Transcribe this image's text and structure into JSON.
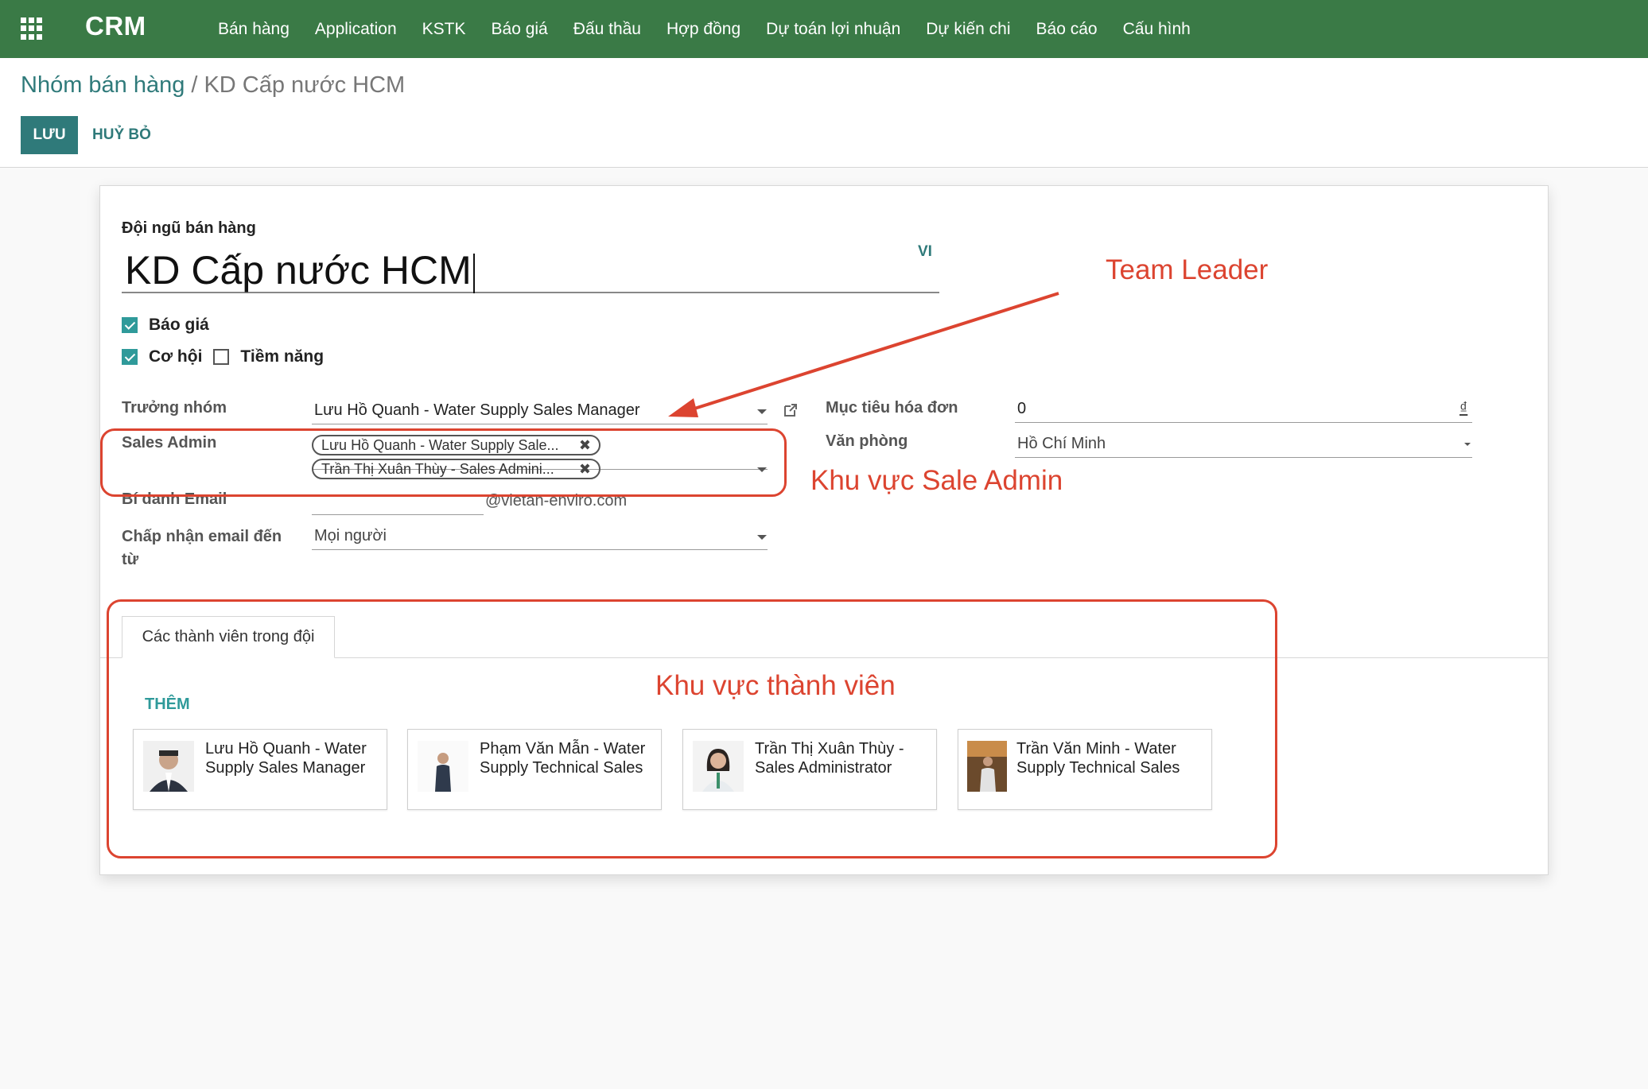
{
  "navbar": {
    "brand": "CRM",
    "menu": [
      "Bán hàng",
      "Application",
      "KSTK",
      "Báo giá",
      "Đấu thầu",
      "Hợp đồng",
      "Dự toán lợi nhuận",
      "Dự kiến chi",
      "Báo cáo",
      "Cấu hình"
    ]
  },
  "breadcrumb": {
    "parent": "Nhóm bán hàng",
    "separator": "/",
    "current": "KD Cấp nước HCM"
  },
  "actions": {
    "save": "LƯU",
    "cancel": "HUỶ BỎ"
  },
  "form": {
    "title_label": "Đội ngũ bán hàng",
    "title_value": "KD Cấp nước HCM",
    "lang": "VI",
    "checkboxes": [
      {
        "label": "Báo giá",
        "checked": true
      },
      {
        "label": "Cơ hội",
        "checked": true
      },
      {
        "label": "Tiềm năng",
        "checked": false
      }
    ],
    "team_leader": {
      "label": "Trưởng nhóm",
      "value": "Lưu Hồ Quanh - Water Supply Sales Manager"
    },
    "sales_admin": {
      "label": "Sales Admin",
      "tags": [
        "Lưu Hồ Quanh - Water Supply Sale...",
        "Trần Thị Xuân Thùy - Sales Admini..."
      ]
    },
    "email_alias": {
      "label": "Bí danh Email",
      "domain": "@vietan-enviro.com"
    },
    "accept_from": {
      "label": "Chấp nhận email đến từ",
      "value": "Mọi người"
    },
    "invoice_target": {
      "label": "Mục tiêu hóa đơn",
      "value": "0",
      "currency": "₫"
    },
    "office": {
      "label": "Văn phòng",
      "value": "Hồ Chí Minh"
    }
  },
  "tabs": {
    "members_tab": "Các thành viên trong đội",
    "add": "THÊM",
    "members": [
      "Lưu Hồ Quanh - Water Supply Sales Manager",
      "Phạm Văn Mẫn - Water Supply Technical Sales",
      "Trần Thị Xuân Thùy - Sales Administrator",
      "Trần Văn Minh - Water Supply Technical Sales"
    ]
  },
  "annotations": {
    "team_leader": "Team Leader",
    "sale_admin": "Khu vực Sale Admin",
    "members": "Khu vực thành viên"
  },
  "colors": {
    "navbar": "#3a7a46",
    "primary": "#2f7a7a",
    "annotation": "#dc4430"
  }
}
